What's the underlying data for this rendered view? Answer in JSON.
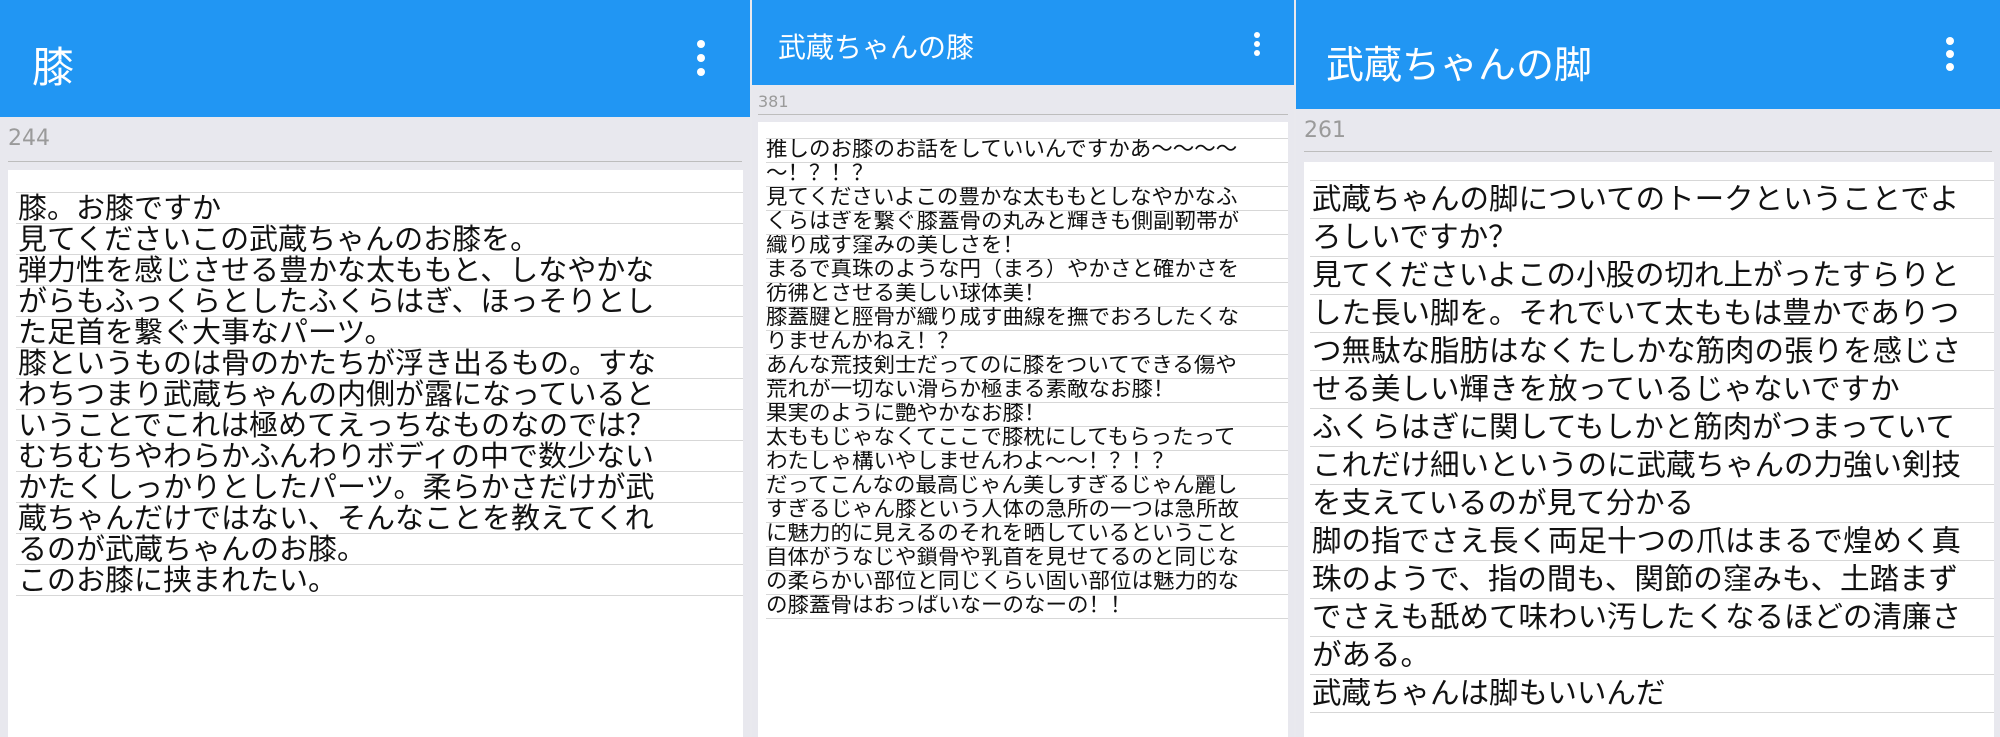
{
  "panels": [
    {
      "title": "膝",
      "count": "244",
      "lines": [
        "膝。お膝ですか",
        "見てくださいこの武蔵ちゃんのお膝を。",
        "弾力性を感じさせる豊かな太ももと、しなやかな",
        "がらもふっくらとしたふくらはぎ、ほっそりとし",
        "た足首を繋ぐ大事なパーツ。",
        "膝というものは骨のかたちが浮き出るもの。すな",
        "わちつまり武蔵ちゃんの内側が露になっていると",
        "いうことでこれは極めてえっちなものなのでは？",
        "むちむちやわらかふんわりボディの中で数少ない",
        "かたくしっかりとしたパーツ。柔らかさだけが武",
        "蔵ちゃんだけではない、そんなことを教えてくれ",
        "るのが武蔵ちゃんのお膝。",
        "このお膝に挟まれたい。"
      ]
    },
    {
      "title": "武蔵ちゃんの膝",
      "count": "381",
      "lines": [
        "推しのお膝のお話をしていいんですかあ〜〜〜〜",
        "〜！？！？",
        "見てくださいよこの豊かな太ももとしなやかなふ",
        "くらはぎを繋ぐ膝蓋骨の丸みと輝きも側副靭帯が",
        "織り成す窪みの美しさを！",
        "まるで真珠のような円（まろ）やかさと確かさを",
        "彷彿とさせる美しい球体美！",
        "膝蓋腱と脛骨が織り成す曲線を撫でおろしたくな",
        "りませんかねえ！？",
        "あんな荒技剣士だってのに膝をついてできる傷や",
        "荒れが一切ない滑らか極まる素敵なお膝！",
        "果実のように艶やかなお膝！",
        "太ももじゃなくてここで膝枕にしてもらったって",
        "わたしゃ構いやしませんわよ〜〜！？！？",
        "だってこんなの最高じゃん美しすぎるじゃん麗し",
        "すぎるじゃん膝という人体の急所の一つは急所故",
        "に魅力的に見えるのそれを晒しているということ",
        "自体がうなじや鎖骨や乳首を見せてるのと同じな",
        "の柔らかい部位と同じくらい固い部位は魅力的な",
        "の膝蓋骨はおっぱいなーのなーの！！"
      ]
    },
    {
      "title": "武蔵ちゃんの脚",
      "count": "261",
      "lines": [
        "武蔵ちゃんの脚についてのトークということでよ",
        "ろしいですか？",
        "見てくださいよこの小股の切れ上がったすらりと",
        "した長い脚を。それでいて太ももは豊かでありつ",
        "つ無駄な脂肪はなくたしかな筋肉の張りを感じさ",
        "せる美しい輝きを放っているじゃないですか",
        "ふくらはぎに関してもしかと筋肉がつまっていて",
        "これだけ細いというのに武蔵ちゃんの力強い剣技",
        "を支えているのが見て分かる",
        "脚の指でさえ長く両足十つの爪はまるで煌めく真",
        "珠のようで、指の間も、関節の窪みも、土踏まず",
        "でさえも舐めて味わい汚したくなるほどの清廉さ",
        "がある。",
        "武蔵ちゃんは脚もいいんだ"
      ]
    }
  ]
}
